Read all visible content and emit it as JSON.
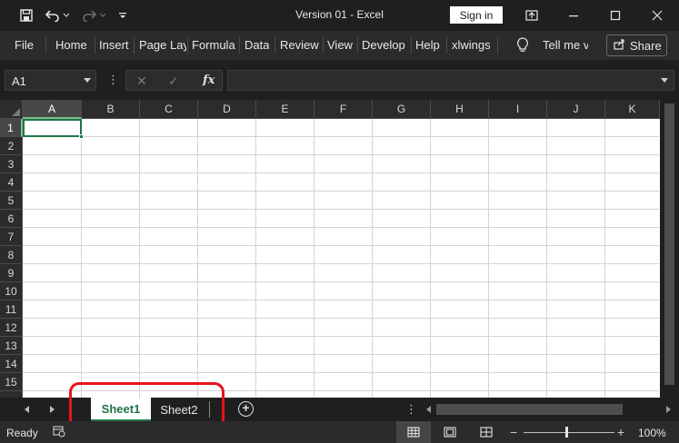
{
  "window": {
    "title": "Version 01  -  Excel",
    "sign_in_label": "Sign in",
    "qat_icons": [
      "save-icon",
      "undo-icon",
      "redo-icon",
      "customize-qat-icon"
    ]
  },
  "ribbon": {
    "tabs": [
      "File",
      "Home",
      "Insert",
      "Page Lay",
      "Formula",
      "Data",
      "Review",
      "View",
      "Develop",
      "Help",
      "xlwings"
    ],
    "tell_me": "Tell me v",
    "share_label": "Share"
  },
  "formula_bar": {
    "name_box": "A1",
    "dots": "⋮",
    "cancel_glyph": "✕",
    "enter_glyph": "✓",
    "fx_label": "fx",
    "formula": ""
  },
  "grid": {
    "columns": [
      "A",
      "B",
      "C",
      "D",
      "E",
      "F",
      "G",
      "H",
      "I",
      "J",
      "K"
    ],
    "rows": [
      "1",
      "2",
      "3",
      "4",
      "5",
      "6",
      "7",
      "8",
      "9",
      "10",
      "11",
      "12",
      "13",
      "14",
      "15"
    ],
    "active_cell": "A1",
    "selected_column": "A",
    "selected_row": "1"
  },
  "sheets": {
    "tabs": [
      "Sheet1",
      "Sheet2"
    ],
    "active": "Sheet1",
    "add_label": "+",
    "dots": "⋮"
  },
  "status": {
    "text": "Ready",
    "zoom_minus": "−",
    "zoom_plus": "+",
    "zoom": "100%",
    "zoom_level": 1.0
  },
  "colors": {
    "accent": "#217346",
    "highlight_ring": "#e8131c",
    "dark_bg": "#1f1f1f"
  }
}
